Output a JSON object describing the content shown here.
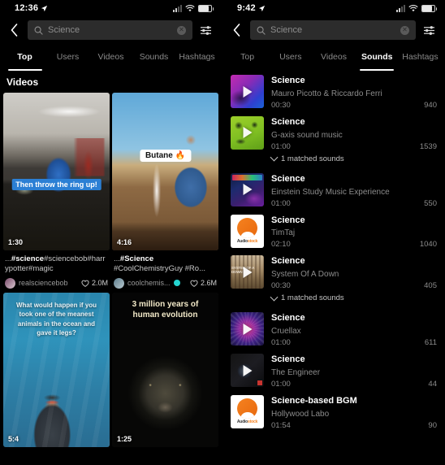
{
  "left": {
    "status": {
      "time": "12:36",
      "location_icon": "location-arrow-icon",
      "wifi_icon": "wifi-icon",
      "battery_icon": "battery-icon",
      "signal_icon": "cellular-signal-icon"
    },
    "search": {
      "back_icon": "back-chevron-icon",
      "search_icon": "search-icon",
      "value": "Science",
      "clear_icon": "clear-circle-icon",
      "filter_icon": "filter-sliders-icon"
    },
    "tabs": [
      {
        "label": "Top",
        "active": true
      },
      {
        "label": "Users",
        "active": false
      },
      {
        "label": "Videos",
        "active": false
      },
      {
        "label": "Sounds",
        "active": false
      },
      {
        "label": "Hashtags",
        "active": false
      }
    ],
    "section_title": "Videos",
    "videos": [
      {
        "overlay_caption": "Then throw the ring up!",
        "duration": "1:30",
        "caption_prefix": "...",
        "caption_bold": "#science",
        "caption_rest": "#sciencebob#harrypotter#magic",
        "username": "realsciencebob",
        "likes": "2.0M",
        "verified": false,
        "like_icon": "heart-icon"
      },
      {
        "overlay_chip": "Butane 🔥",
        "duration": "4:16",
        "caption_prefix": "...",
        "caption_bold": "#Science",
        "caption_rest": "#CoolChemistryGuy #Ro...",
        "username": "coolchemis...",
        "likes": "2.6M",
        "verified": true,
        "like_icon": "heart-icon"
      },
      {
        "overlay_text": "What would happen if you took one of the meanest animals in the ocean and gave it legs?",
        "duration": "5:4"
      },
      {
        "overlay_text": "3 million years of human evolution",
        "duration": "1:25"
      }
    ]
  },
  "right": {
    "status": {
      "time": "9:42",
      "location_icon": "location-arrow-icon",
      "wifi_icon": "wifi-icon",
      "battery_icon": "battery-icon",
      "signal_icon": "cellular-signal-icon"
    },
    "search": {
      "back_icon": "back-chevron-icon",
      "search_icon": "search-icon",
      "value": "Science",
      "clear_icon": "clear-circle-icon",
      "filter_icon": "filter-sliders-icon"
    },
    "tabs": [
      {
        "label": "Top",
        "active": false
      },
      {
        "label": "Users",
        "active": false
      },
      {
        "label": "Videos",
        "active": false
      },
      {
        "label": "Sounds",
        "active": true
      },
      {
        "label": "Hashtags",
        "active": false
      }
    ],
    "sounds": [
      {
        "title": "Science",
        "author": "Mauro Picotto & Riccardo Ferri",
        "duration": "00:30",
        "count": "940",
        "cover": "purple-blue-concert",
        "matched": null
      },
      {
        "title": "Science",
        "author": "G-axis sound music",
        "duration": "01:00",
        "count": "1539",
        "cover": "green-art",
        "matched": "1 matched sounds"
      },
      {
        "title": "Science",
        "author": "Einstein Study Music Experience",
        "duration": "01:00",
        "count": "550",
        "cover": "studying-music-album",
        "matched": null
      },
      {
        "title": "Science",
        "author": "TimTaj",
        "duration": "02:10",
        "count": "1040",
        "cover": "audiostock",
        "matched": null
      },
      {
        "title": "Science",
        "author": "System Of A Down",
        "duration": "00:30",
        "count": "405",
        "cover": "desert-album",
        "matched": "1 matched sounds"
      },
      {
        "title": "Science",
        "author": "Cruellax",
        "duration": "01:00",
        "count": "611",
        "cover": "magenta-fractal",
        "matched": null
      },
      {
        "title": "Science",
        "author": "The Engineer",
        "duration": "01:00",
        "count": "44",
        "cover": "dark-energy-album",
        "matched": null
      },
      {
        "title": "Science-based BGM",
        "author": "Hollywood Labo",
        "duration": "01:54",
        "count": "90",
        "cover": "audiostock",
        "matched": null
      }
    ],
    "matched_chevron_icon": "chevron-down-icon",
    "play_icon": "play-triangle-icon"
  },
  "colors": {
    "background": "#000000",
    "field": "#2c2c2c",
    "muted": "#8c8c8c",
    "accent": "#ffffff",
    "verified": "#25d4d0"
  }
}
